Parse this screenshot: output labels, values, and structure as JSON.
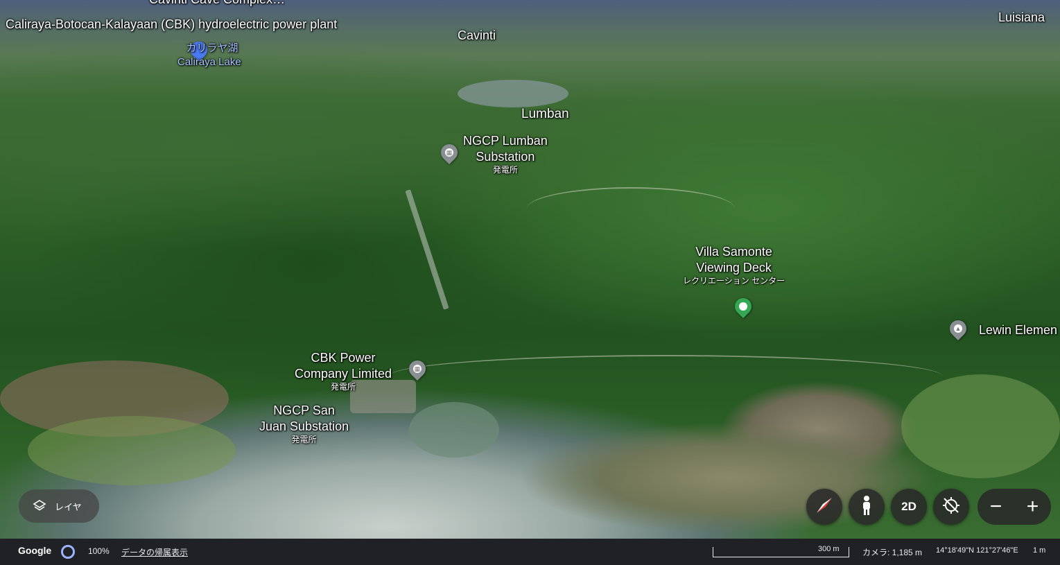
{
  "map": {
    "labels": {
      "top_cut": "Cavinti Cave Complex…",
      "cbk_plant": "Caliraya-Botocan-Kalayaan (CBK) hydroelectric power plant",
      "caliraya_jp": "カリラヤ湖",
      "caliraya_en": "Caliraya Lake",
      "cavinti": "Cavinti",
      "luisiana": "Luisiana",
      "lumban": "Lumban",
      "ngcp_lumban_1": "NGCP Lumban",
      "ngcp_lumban_2": "Substation",
      "ngcp_lumban_type": "発電所",
      "villa_1": "Villa Samonte",
      "villa_2": "Viewing Deck",
      "villa_type": "レクリエーション センター",
      "lewin": "Lewin Elemen",
      "cbk_power_1": "CBK Power",
      "cbk_power_2": "Company Limited",
      "cbk_power_type": "発電所",
      "ngcp_sanjuan_1": "NGCP San",
      "ngcp_sanjuan_2": "Juan Substation",
      "ngcp_sanjuan_type": "発電所"
    },
    "pin_colors": {
      "selected": "#4a7af0",
      "facility": "#8a8f94",
      "recreation": "#34a853",
      "school": "#8a8f94"
    }
  },
  "controls": {
    "layers_label": "レイヤ",
    "compass_icon": "compass-icon",
    "street_view_icon": "pegman-icon",
    "view_toggle": "2D",
    "reset_tilt_icon": "tilt-reset-icon",
    "zoom_out": "−",
    "zoom_in": "+"
  },
  "status": {
    "logo": "Google",
    "loading_pct": "100%",
    "attribution": "データの帰属表示",
    "scale_label": "300 m",
    "camera": "カメラ: 1,185 m",
    "coordinates": "14°18'49\"N 121°27'46\"E",
    "elevation": "1 m"
  }
}
